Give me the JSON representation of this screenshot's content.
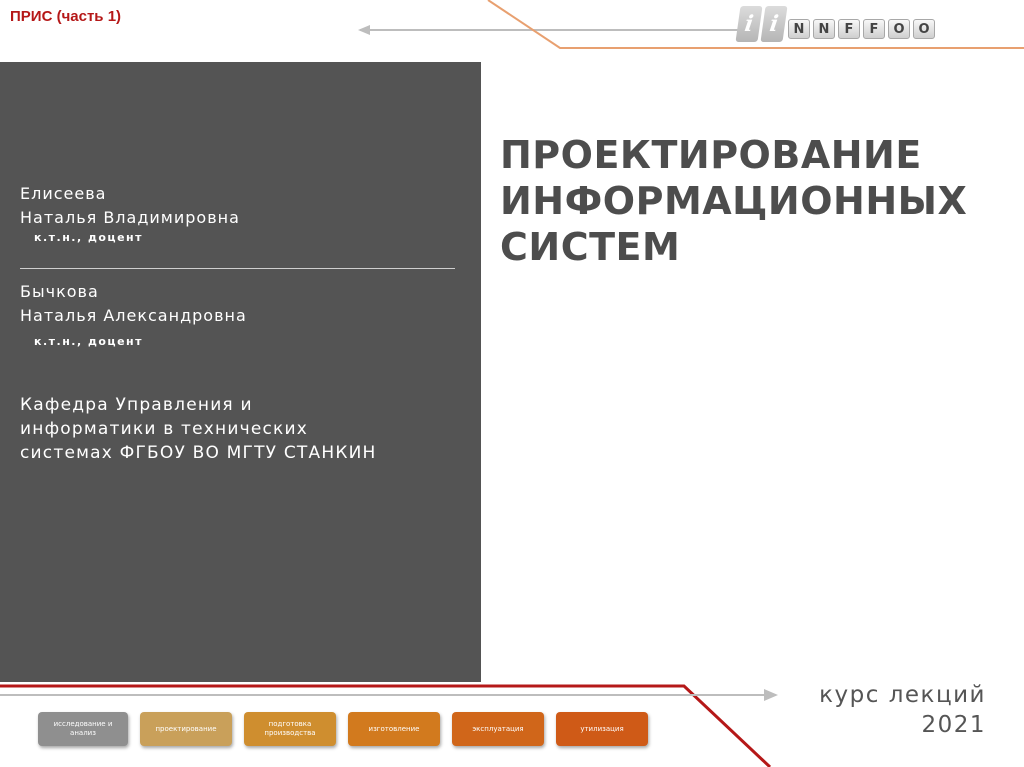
{
  "header": {
    "title": "ПРИС (часть 1)"
  },
  "logo": {
    "i_marks": [
      "i",
      "i"
    ],
    "letters": [
      "N",
      "N",
      "F",
      "F",
      "O",
      "O"
    ]
  },
  "authors": [
    {
      "surname": "Елисеева",
      "given": "Наталья Владимировна",
      "degree": "к.т.н., доцент"
    },
    {
      "surname": "Бычкова",
      "given": "Наталья Александровна",
      "degree": "к.т.н., доцент"
    }
  ],
  "department": [
    "Кафедра Управления и",
    "информатики в технических",
    "системах ФГБОУ ВО МГТУ СТАНКИН"
  ],
  "title_lines": [
    "ПРОЕКТИРОВАНИЕ",
    "ИНФОРМАЦИОННЫХ",
    "СИСТЕМ"
  ],
  "course": {
    "label": "курс лекций",
    "year": "2021"
  },
  "stages": [
    {
      "line1": "исследование и",
      "line2": "анализ",
      "color": "#8f8f8f"
    },
    {
      "line1": "проектирование",
      "line2": "",
      "color": "#c9a05a"
    },
    {
      "line1": "подготовка",
      "line2": "производства",
      "color": "#cf8e2f"
    },
    {
      "line1": "изготовление",
      "line2": "",
      "color": "#d27a1e"
    },
    {
      "line1": "эксплуатация",
      "line2": "",
      "color": "#d0661a"
    },
    {
      "line1": "утилизация",
      "line2": "",
      "color": "#cf5a17"
    }
  ],
  "colors": {
    "panel": "#545454",
    "accent_red": "#b51818",
    "accent_orange": "#e8a070",
    "title": "#4d4d4d"
  }
}
